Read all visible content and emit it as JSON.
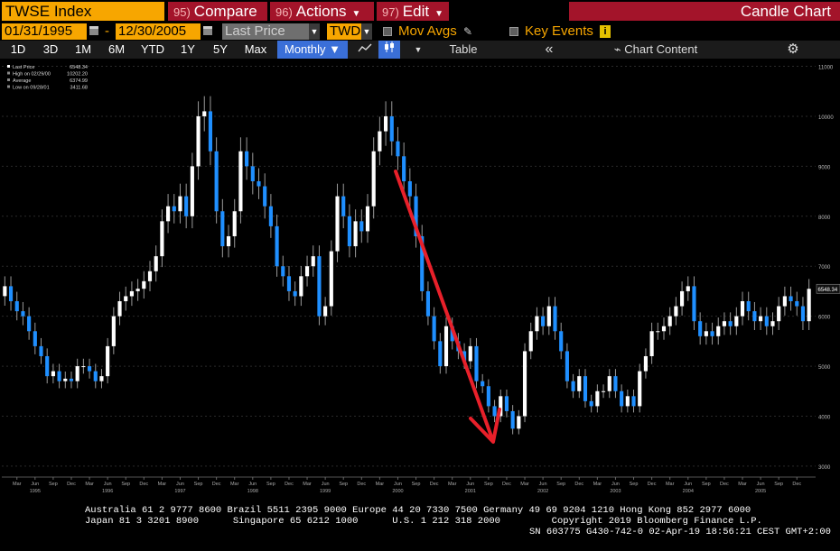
{
  "header": {
    "ticker": "TWSE Index",
    "compare": {
      "num": "95)",
      "label": "Compare"
    },
    "actions": {
      "num": "96)",
      "label": "Actions"
    },
    "edit": {
      "num": "97)",
      "label": "Edit"
    },
    "chart_title": "Candle Chart"
  },
  "dates": {
    "start": "01/31/1995",
    "separator": "-",
    "end": "12/30/2005",
    "field": "Last Price",
    "currency": "TWD",
    "mov_avgs": "Mov Avgs",
    "key_events": "Key Events",
    "info_badge": "i"
  },
  "toolbar": {
    "periods": [
      "1D",
      "3D",
      "1M",
      "6M",
      "YTD",
      "1Y",
      "5Y",
      "Max"
    ],
    "frequency": "Monthly",
    "table": "Table",
    "collapse": "«",
    "chart_content": "Chart Content",
    "gear": "⚙"
  },
  "legend": {
    "rows": [
      {
        "label": "Last Price",
        "value": "6548.34"
      },
      {
        "label": "High on 02/29/00",
        "value": "10202.20"
      },
      {
        "label": "Average",
        "value": "6374.99"
      },
      {
        "label": "Low on 09/28/01",
        "value": "3411.68"
      }
    ]
  },
  "colors": {
    "up": "#ffffff",
    "down": "#1f8fff",
    "wick": "#9a9a9a",
    "arrow": "#e8202a",
    "ticker_bg": "#f7a600",
    "menu_bg": "#a3142a"
  },
  "chart_data": {
    "type": "candlestick",
    "frequency": "monthly",
    "y_ticks": [
      3000,
      4000,
      5000,
      6000,
      7000,
      8000,
      9000,
      10000,
      11000
    ],
    "ylim": [
      2800,
      11100
    ],
    "x_month_labels": [
      "Mar",
      "Jun",
      "Sep",
      "Dec"
    ],
    "x_year_labels": [
      "1995",
      "1996",
      "1997",
      "1998",
      "1999",
      "2000",
      "2001",
      "2002",
      "2003",
      "2004",
      "2005"
    ],
    "last_price_label": "6548.34",
    "last_price": 6548.34,
    "closes": [
      6600,
      6300,
      6100,
      6000,
      5700,
      5400,
      5200,
      4800,
      4900,
      4700,
      4750,
      4700,
      5000,
      5000,
      4900,
      4700,
      4800,
      5400,
      6000,
      6300,
      6400,
      6500,
      6550,
      6700,
      6900,
      7200,
      7900,
      8200,
      8100,
      8400,
      8000,
      9000,
      10000,
      10100,
      9300,
      8100,
      7400,
      7600,
      8100,
      9300,
      9000,
      8700,
      8600,
      8200,
      7800,
      7000,
      6800,
      6500,
      6400,
      6800,
      7000,
      7200,
      6000,
      6200,
      7300,
      8400,
      8000,
      7400,
      7900,
      7700,
      8200,
      9300,
      9700,
      10000,
      9500,
      9200,
      8700,
      8400,
      7600,
      6500,
      6000,
      5500,
      5000,
      5800,
      5500,
      5300,
      5100,
      5400,
      4700,
      4600,
      4200,
      4000,
      4400,
      4100,
      3750,
      4000,
      5300,
      5700,
      6000,
      5800,
      6200,
      5700,
      5300,
      4700,
      4500,
      4800,
      4300,
      4200,
      4500,
      4500,
      4800,
      4500,
      4200,
      4400,
      4200,
      4900,
      5200,
      5700,
      5700,
      5800,
      6000,
      6200,
      6500,
      6600,
      5900,
      5600,
      5700,
      5600,
      5800,
      5900,
      5800,
      6000,
      6300,
      6100,
      5900,
      6000,
      5800,
      5900,
      6200,
      6400,
      6300,
      6200,
      5900,
      6548
    ],
    "annotation": "red trend arrow from early 2000 peak to 2001 low"
  },
  "footer": {
    "line1": "Australia 61 2 9777 8600 Brazil 5511 2395 9000 Europe 44 20 7330 7500 Germany 49 69 9204 1210 Hong Kong 852 2977 6000",
    "line2": "Japan 81 3 3201 8900      Singapore 65 6212 1000      U.S. 1 212 318 2000         Copyright 2019 Bloomberg Finance L.P.",
    "line3": "SN 603775 G430-742-0 02-Apr-19 18:56:21 CEST GMT+2:00"
  }
}
